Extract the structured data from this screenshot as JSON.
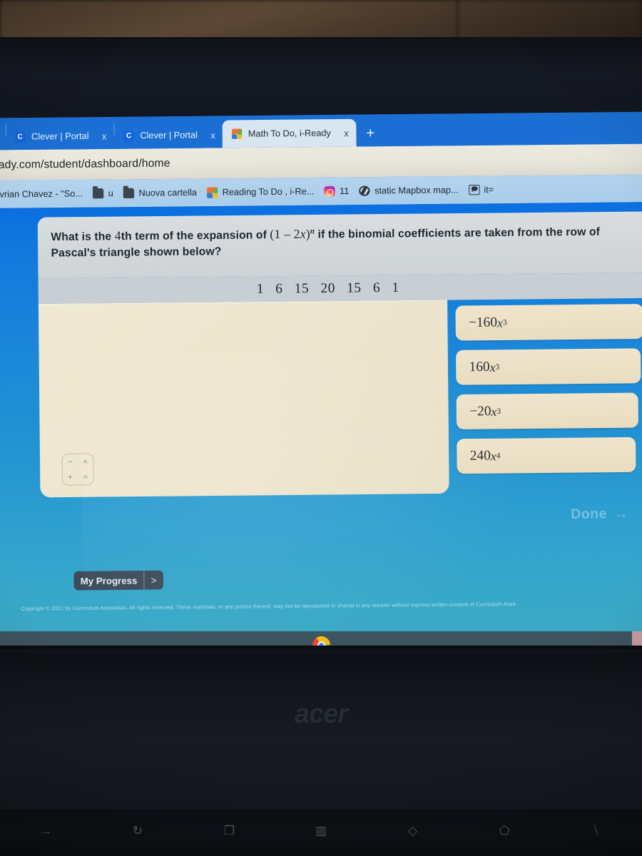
{
  "browser": {
    "tabs": [
      {
        "title": "Clever | Portal",
        "favicon": "clever-icon",
        "active": false,
        "clipped": true
      },
      {
        "title": "Clever | Portal",
        "favicon": "clever-icon",
        "active": false,
        "clipped": false
      },
      {
        "title": "Math To Do, i-Ready",
        "favicon": "iready-cube-icon",
        "active": true,
        "clipped": false
      }
    ],
    "close_label": "x",
    "new_tab_label": "+",
    "clever_favicon_letter": "C",
    "url": "eady.com/student/dashboard/home",
    "bookmarks": [
      {
        "label": "Avrian Chavez - \"So...",
        "icon": "none"
      },
      {
        "label": "u",
        "icon": "folder-icon"
      },
      {
        "label": "Nuova cartella",
        "icon": "folder-icon"
      },
      {
        "label": "Reading To Do , i-Re...",
        "icon": "iready-cube-icon"
      },
      {
        "label": "11",
        "icon": "instagram-icon"
      },
      {
        "label": "static Mapbox map...",
        "icon": "globe-icon"
      },
      {
        "label": "it=",
        "icon": "box-icon"
      }
    ]
  },
  "question": {
    "line1_a": "What is the ",
    "line1_ordinal": "4",
    "line1_b": "th term of the expansion of ",
    "expression_open": "(1 ",
    "expression_minus": "– ",
    "expression_coef": "2",
    "expression_var": "x",
    "expression_close": ")",
    "expression_exponent": "n",
    "line1_c": " if the binomial coefficients are taken from the row of",
    "line2": "Pascal's triangle shown below?",
    "pascal_row": [
      "1",
      "6",
      "15",
      "20",
      "15",
      "6",
      "1"
    ]
  },
  "choices": [
    {
      "text": "−160x³",
      "display": "−160",
      "var": "x",
      "exp": "3"
    },
    {
      "text": "160x³",
      "display": "160",
      "var": "x",
      "exp": "3"
    },
    {
      "text": "−20x³",
      "display": "−20",
      "var": "x",
      "exp": "3"
    },
    {
      "text": "240x⁴",
      "display": "240",
      "var": "x",
      "exp": "4"
    }
  ],
  "calculator_widget": {
    "keys": [
      "−",
      "×",
      "+",
      "="
    ]
  },
  "actions": {
    "done_label": "Done",
    "done_arrow": "→",
    "my_progress_label": "My Progress",
    "my_progress_arrow": ">"
  },
  "footer": {
    "copyright": "Copyright © 2021 by Curriculum Associates. All rights reserved. These materials, or any portion thereof, may not be reproduced or shared in any manner without express written consent of Curriculum Asso"
  },
  "shelf": {
    "apps": [
      {
        "name": "chrome-icon"
      }
    ]
  },
  "hardware": {
    "brand": "acer",
    "function_keys": [
      {
        "name": "forward-key",
        "glyph": "→"
      },
      {
        "name": "reload-key",
        "glyph": "↻"
      },
      {
        "name": "fullscreen-key",
        "glyph": "❐"
      },
      {
        "name": "overview-key",
        "glyph": "▥"
      },
      {
        "name": "brightness-down-key",
        "glyph": "◇"
      },
      {
        "name": "brightness-up-key",
        "glyph": "⬠"
      },
      {
        "name": "mute-key",
        "glyph": "⧹"
      }
    ]
  },
  "colors": {
    "chrome_blue": "#1b6fd4",
    "page_top_blue": "#0b6fe0",
    "page_bottom_blue": "#3da9c4",
    "card_gray": "#d9dde0",
    "choice_cream": "#f0e4cc",
    "progress_dark": "#3c4c5b"
  }
}
